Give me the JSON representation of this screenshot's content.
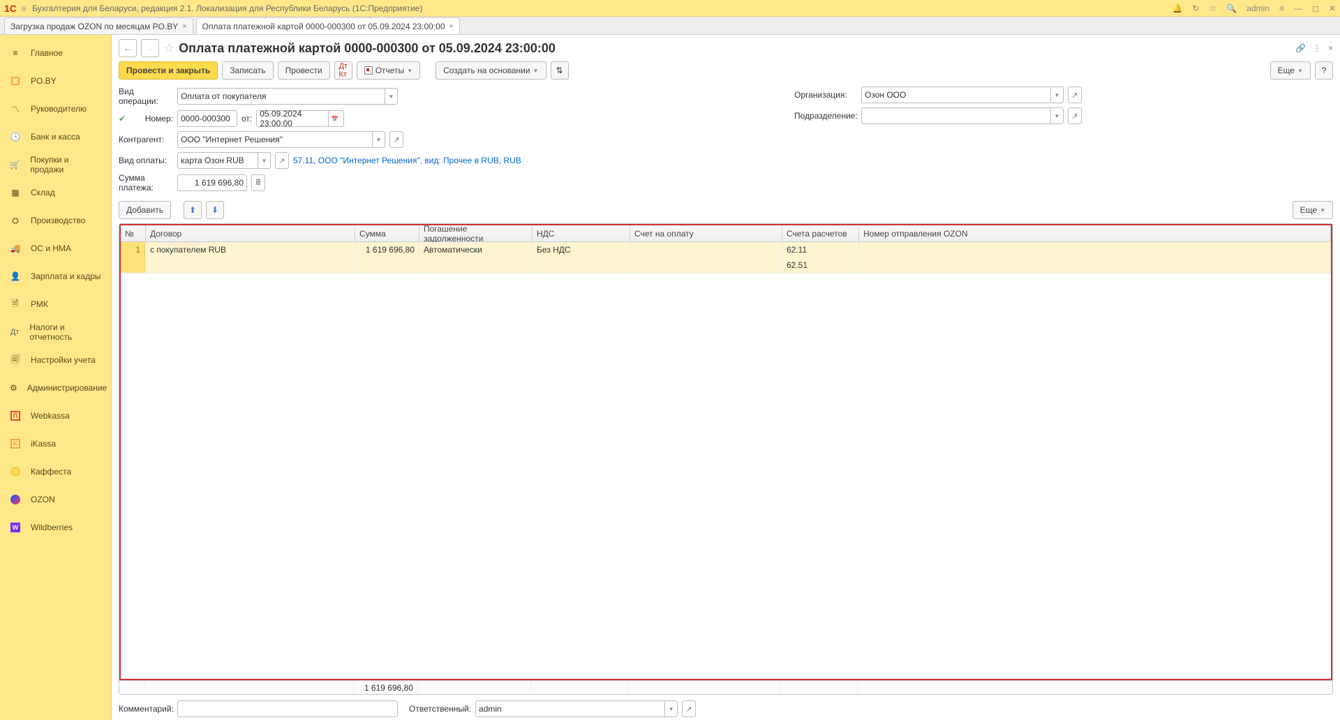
{
  "app_title": "Бухгалтерия для Беларуси, редакция 2.1. Локализация для Республики Беларусь  (1С:Предприятие)",
  "admin_label": "admin",
  "tabs": [
    {
      "label": "Загрузка продаж OZON по месяцам PO.BY"
    },
    {
      "label": "Оплата платежной картой 0000-000300 от 05.09.2024 23:00:00"
    }
  ],
  "sidebar": [
    {
      "label": "Главное",
      "icon": "≡"
    },
    {
      "label": "PO.BY",
      "icon": "orange-sq"
    },
    {
      "label": "Руководителю",
      "icon": "📈"
    },
    {
      "label": "Банк и касса",
      "icon": "🕓"
    },
    {
      "label": "Покупки и продажи",
      "icon": "🛒"
    },
    {
      "label": "Склад",
      "icon": "▦"
    },
    {
      "label": "Производство",
      "icon": "⛭"
    },
    {
      "label": "ОС и НМА",
      "icon": "🚚"
    },
    {
      "label": "Зарплата и кадры",
      "icon": "👤"
    },
    {
      "label": "РМК",
      "icon": "🗎"
    },
    {
      "label": "Налоги и отчетность",
      "icon": "Дт"
    },
    {
      "label": "Настройки учета",
      "icon": "🗐"
    },
    {
      "label": "Администрирование",
      "icon": "⚙"
    },
    {
      "label": "Webkassa",
      "icon": "wk"
    },
    {
      "label": "iKassa",
      "icon": "ik"
    },
    {
      "label": "Каффеста",
      "icon": "circle-y"
    },
    {
      "label": "OZON",
      "icon": "ozon"
    },
    {
      "label": "Wildberries",
      "icon": "wb"
    }
  ],
  "doc_title": "Оплата платежной картой 0000-000300 от 05.09.2024 23:00:00",
  "buttons": {
    "post_close": "Провести и закрыть",
    "write": "Записать",
    "post": "Провести",
    "reports": "Отчеты",
    "create_based": "Создать на основании",
    "more": "Еще",
    "add": "Добавить"
  },
  "labels": {
    "op_type": "Вид операции:",
    "number": "Номер:",
    "from": "от:",
    "counterparty": "Контрагент:",
    "pay_type": "Вид оплаты:",
    "pay_sum": "Сумма платежа:",
    "organization": "Организация:",
    "division": "Подразделение:",
    "comment": "Комментарий:",
    "responsible": "Ответственный:"
  },
  "form": {
    "op_type": "Оплата от покупателя",
    "number": "0000-000300",
    "date": "05.09.2024 23:00:00",
    "counterparty": "ООО \"Интернет Решения\"",
    "pay_type": "карта Озон RUB",
    "pay_type_link": "57.11, ООО \"Интернет Решения\", вид: Прочее в RUB, RUB",
    "pay_sum": "1 619 696,80",
    "organization": "Озон ООО",
    "division": "",
    "responsible": "admin",
    "comment": ""
  },
  "table": {
    "headers": {
      "num": "№",
      "contract": "Договор",
      "sum": "Сумма",
      "repay": "Погашение задолженности",
      "vat": "НДС",
      "invoice": "Счет на оплату",
      "accounts": "Счета расчетов",
      "ozon_no": "Номер отправления OZON"
    },
    "row": {
      "num": "1",
      "contract": "с покупателем RUB",
      "sum": "1 619 696,80",
      "repay": "Автоматически",
      "vat": "Без НДС",
      "invoice": "",
      "acc1": "62.11",
      "acc2": "62.51",
      "ozon_no": ""
    },
    "footer_sum": "1 619 696,80"
  }
}
